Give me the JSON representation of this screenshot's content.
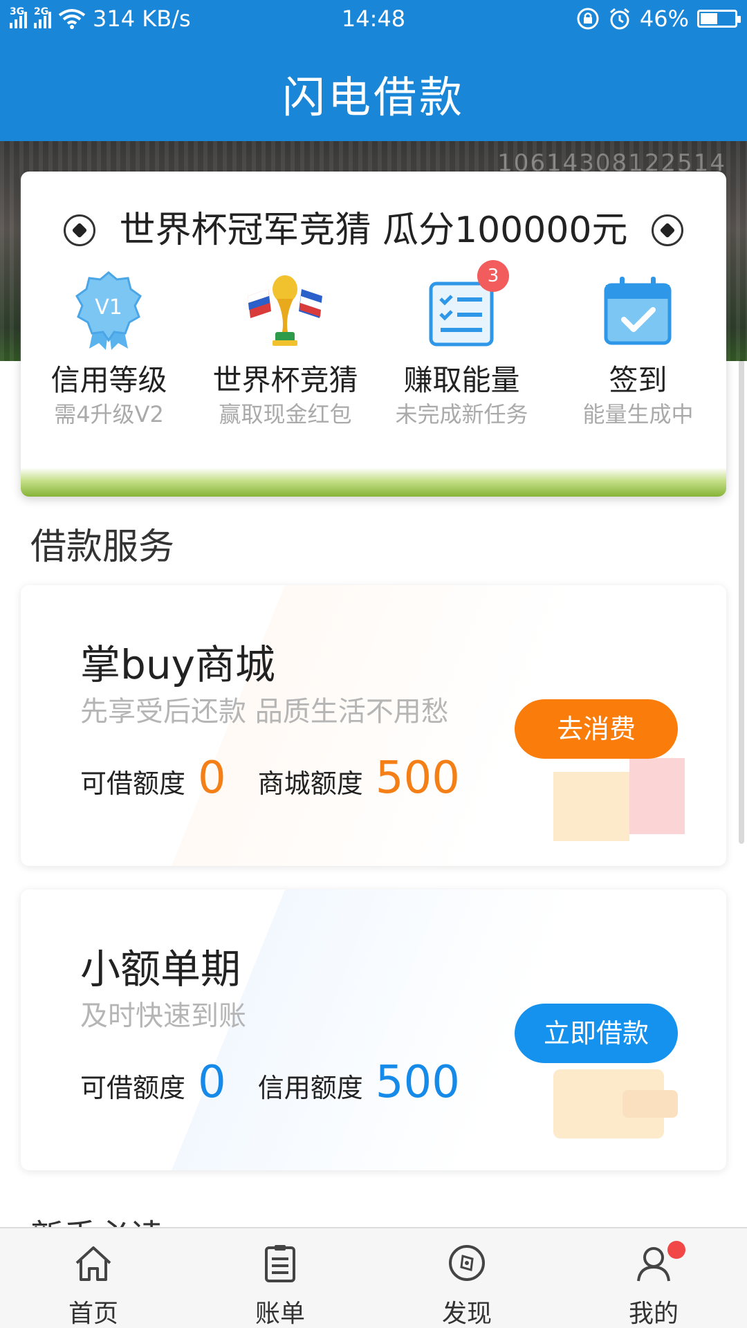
{
  "status_bar": {
    "network_1": "3G",
    "network_2": "2G",
    "speed": "314 KB/s",
    "time": "14:48",
    "battery": "46%",
    "battery_level": 0.46
  },
  "app_title": "闪电借款",
  "hero": {
    "code_text": "10614308122514",
    "promo_title": "世界杯冠军竞猜  瓜分100000元",
    "features": [
      {
        "title": "信用等级",
        "sub": "需4升级V2",
        "icon": "v1-medal-icon",
        "icon_text": "V1"
      },
      {
        "title": "世界杯竞猜",
        "sub": "赢取现金红包",
        "icon": "world-cup-trophy-icon"
      },
      {
        "title": "赚取能量",
        "sub": "未完成新任务",
        "icon": "task-list-icon",
        "badge": "3"
      },
      {
        "title": "签到",
        "sub": "能量生成中",
        "icon": "calendar-check-icon"
      }
    ]
  },
  "section_title": "借款服务",
  "services": {
    "shop": {
      "title": "掌buy商城",
      "subtitle": "先享受后还款 品质生活不用愁",
      "q1_label": "可借额度",
      "q1_value": "0",
      "q2_label": "商城额度",
      "q2_value": "500",
      "button": "去消费"
    },
    "loan": {
      "title": "小额单期",
      "subtitle": "及时快速到账",
      "q1_label": "可借额度",
      "q1_value": "0",
      "q2_label": "信用额度",
      "q2_value": "500",
      "button": "立即借款"
    }
  },
  "partial_section_title": "新手必读",
  "bottom_nav": [
    {
      "label": "首页",
      "icon": "home-icon"
    },
    {
      "label": "账单",
      "icon": "bill-icon"
    },
    {
      "label": "发现",
      "icon": "compass-icon"
    },
    {
      "label": "我的",
      "icon": "user-icon"
    }
  ],
  "colors": {
    "primary": "#1a86d8",
    "orange": "#fa7d0c",
    "blue_button": "#1591ee",
    "badge_red": "#f25c5c"
  }
}
